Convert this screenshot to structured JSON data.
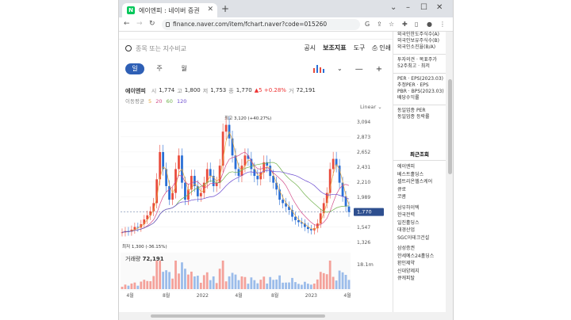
{
  "browser": {
    "tab_title": "에이엔피 : 네이버 증권",
    "favicon": "N",
    "url": "finance.naver.com/item/fchart.naver?code=015260"
  },
  "search": {
    "placeholder": "종목 또는 지수비교"
  },
  "toplinks": [
    "공시",
    "보조지표",
    "도구",
    "인쇄"
  ],
  "periods": [
    "일",
    "주",
    "월"
  ],
  "stock": {
    "name": "에이엔피",
    "open_label": "시",
    "open": "1,774",
    "high_label": "고",
    "high": "1,800",
    "low_label": "저",
    "low": "1,753",
    "close_label": "종",
    "close": "1,770",
    "change": "▲5 +0.28%",
    "volume_label": "거",
    "volume": "72,191"
  },
  "ma": {
    "label": "이동평균",
    "values": [
      "5",
      "20",
      "60",
      "120"
    ]
  },
  "scale_label": "Linear",
  "chart_data": {
    "type": "line",
    "y_ticks": [
      "3,094",
      "2,873",
      "2,652",
      "2,431",
      "2,210",
      "1,989",
      "1,770",
      "1,547",
      "1,326"
    ],
    "x_ticks": [
      "4월",
      "8월",
      "2022",
      "4월",
      "8월",
      "2023",
      "4월"
    ],
    "ylim": [
      1300,
      3150
    ],
    "max_label": "최고 3,120 (+40.27%)",
    "min_label": "최저 1,300 (-36.15%)",
    "current": "1,770",
    "volume_title": "거래량",
    "volume_value": "72,191",
    "volume_max": "18.1m",
    "close": [
      1470,
      1490,
      1480,
      1510,
      1550,
      1540,
      1590,
      1660,
      1720,
      1780,
      1900,
      2250,
      2650,
      2400,
      2150,
      1950,
      2050,
      2400,
      2600,
      2200,
      1950,
      2100,
      2300,
      2150,
      2000,
      2050,
      2200,
      2400,
      2300,
      2150,
      2200,
      2450,
      2950,
      3050,
      2850,
      2600,
      2400,
      2300,
      2450,
      2600,
      2550,
      2400,
      2300,
      2250,
      2350,
      2500,
      2450,
      2300,
      2200,
      2100,
      1950,
      1900,
      1850,
      1800,
      1700,
      1650,
      1620,
      1600,
      1550,
      1520,
      1500,
      1530,
      1600,
      1750,
      1900,
      2050,
      2400,
      2550,
      2450,
      2200,
      2000,
      1850,
      1770
    ],
    "colors": {
      "up": "#e94b3c",
      "down": "#2a6fd6",
      "ma5": "#e6a53a",
      "ma20": "#d24c8a",
      "ma60": "#6fb04b",
      "ma120": "#6b4bd0",
      "current_bg": "#2e4f8f"
    }
  },
  "sidebar": {
    "items_top": [
      "외국인한도주식수(A)",
      "외국인보유주식수(B)",
      "외국인소진율(B/A)"
    ],
    "items_mid": [
      "투자의견 · 목표주가",
      "52주최고 · 최저"
    ],
    "items_per": [
      "PER · EPS(2023.03)",
      "추정PER · EPS",
      "PBR · BPS(2023.03)",
      "배당수익률"
    ],
    "items_ind": [
      "동일업종 PER",
      "동일업종 등락률"
    ],
    "recent_title": "최근조회",
    "recent_items": [
      "에이엔피",
      "베스트홀딩스",
      "셀트리온헬스케어",
      "큐로",
      "코콤",
      "삼우하이텍",
      "한국전력",
      "일진홀딩스",
      "대경산업",
      "SGC이테크건설",
      "삼성증권",
      "한세예스24홀딩스",
      "환인제약",
      "신대양제지",
      "큐캐피탈"
    ]
  }
}
